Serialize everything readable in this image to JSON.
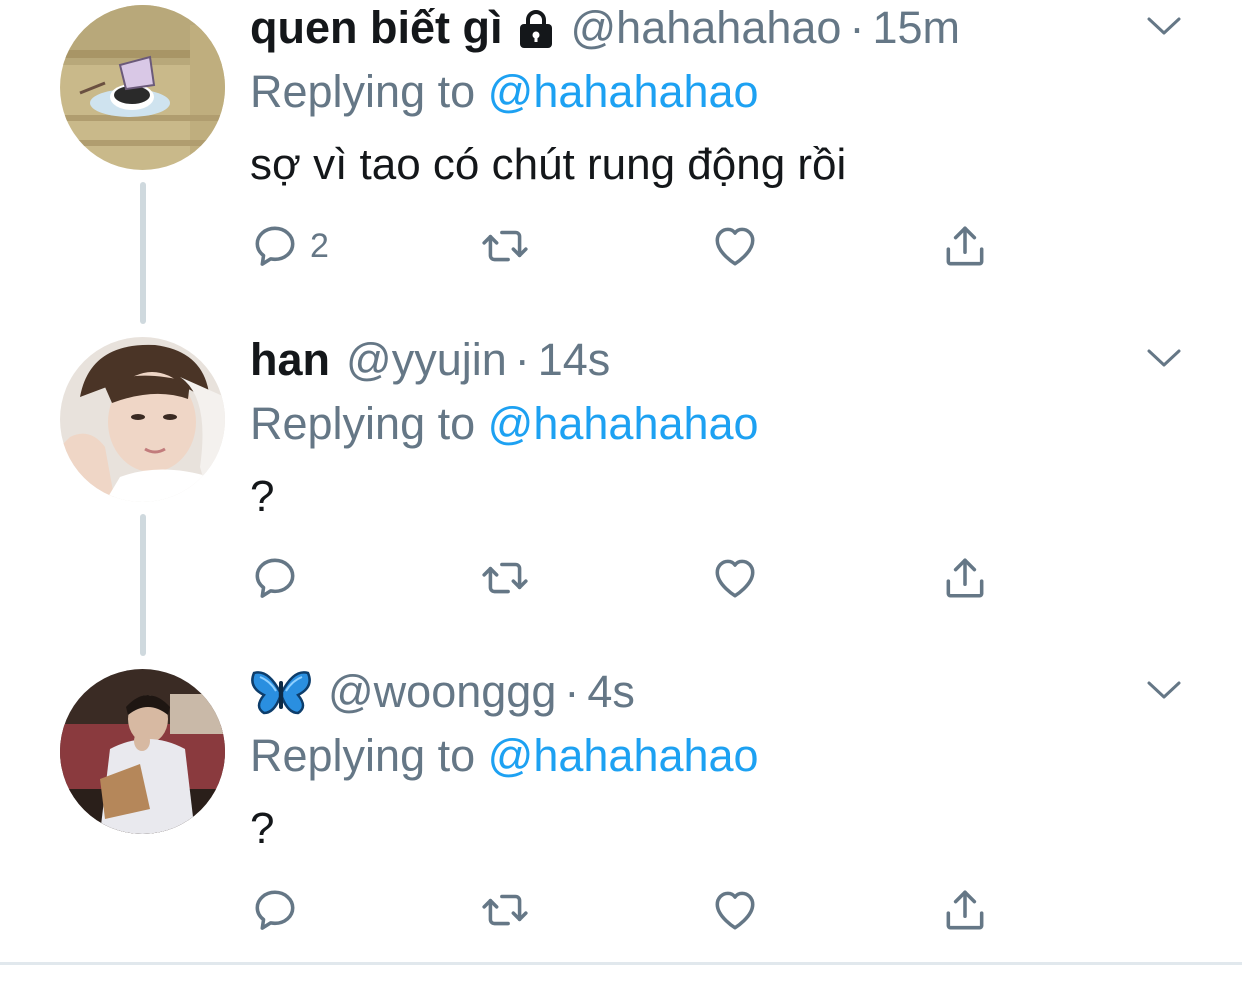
{
  "colors": {
    "accent": "#1da1f2",
    "secondary_text": "#657786",
    "primary_text": "#14171a",
    "thread_line": "#cfd9de"
  },
  "tweets": [
    {
      "name": "quen biết gì",
      "protected_icon": "lock-icon",
      "handle": "@hahahahao",
      "dot": "·",
      "time": "15m",
      "replying_prefix": "Replying to",
      "replying_to": "@hahahahao",
      "text": "sợ vì tao có chút rung động rồi",
      "reply_count": "2",
      "avatar": "cartoon-character-avatar"
    },
    {
      "name": "han",
      "handle": "@yyujin",
      "dot": "·",
      "time": "14s",
      "replying_prefix": "Replying to",
      "replying_to": "@hahahahao",
      "text": "?",
      "reply_count": "",
      "avatar": "person-photo-avatar"
    },
    {
      "name_icon": "blue-butterfly-icon",
      "handle": "@woonggg",
      "dot": "·",
      "time": "4s",
      "replying_prefix": "Replying to",
      "replying_to": "@hahahahao",
      "text": "?",
      "reply_count": "",
      "avatar": "person-photo-avatar"
    }
  ],
  "action_icons": [
    "reply-icon",
    "retweet-icon",
    "like-icon",
    "share-icon"
  ]
}
